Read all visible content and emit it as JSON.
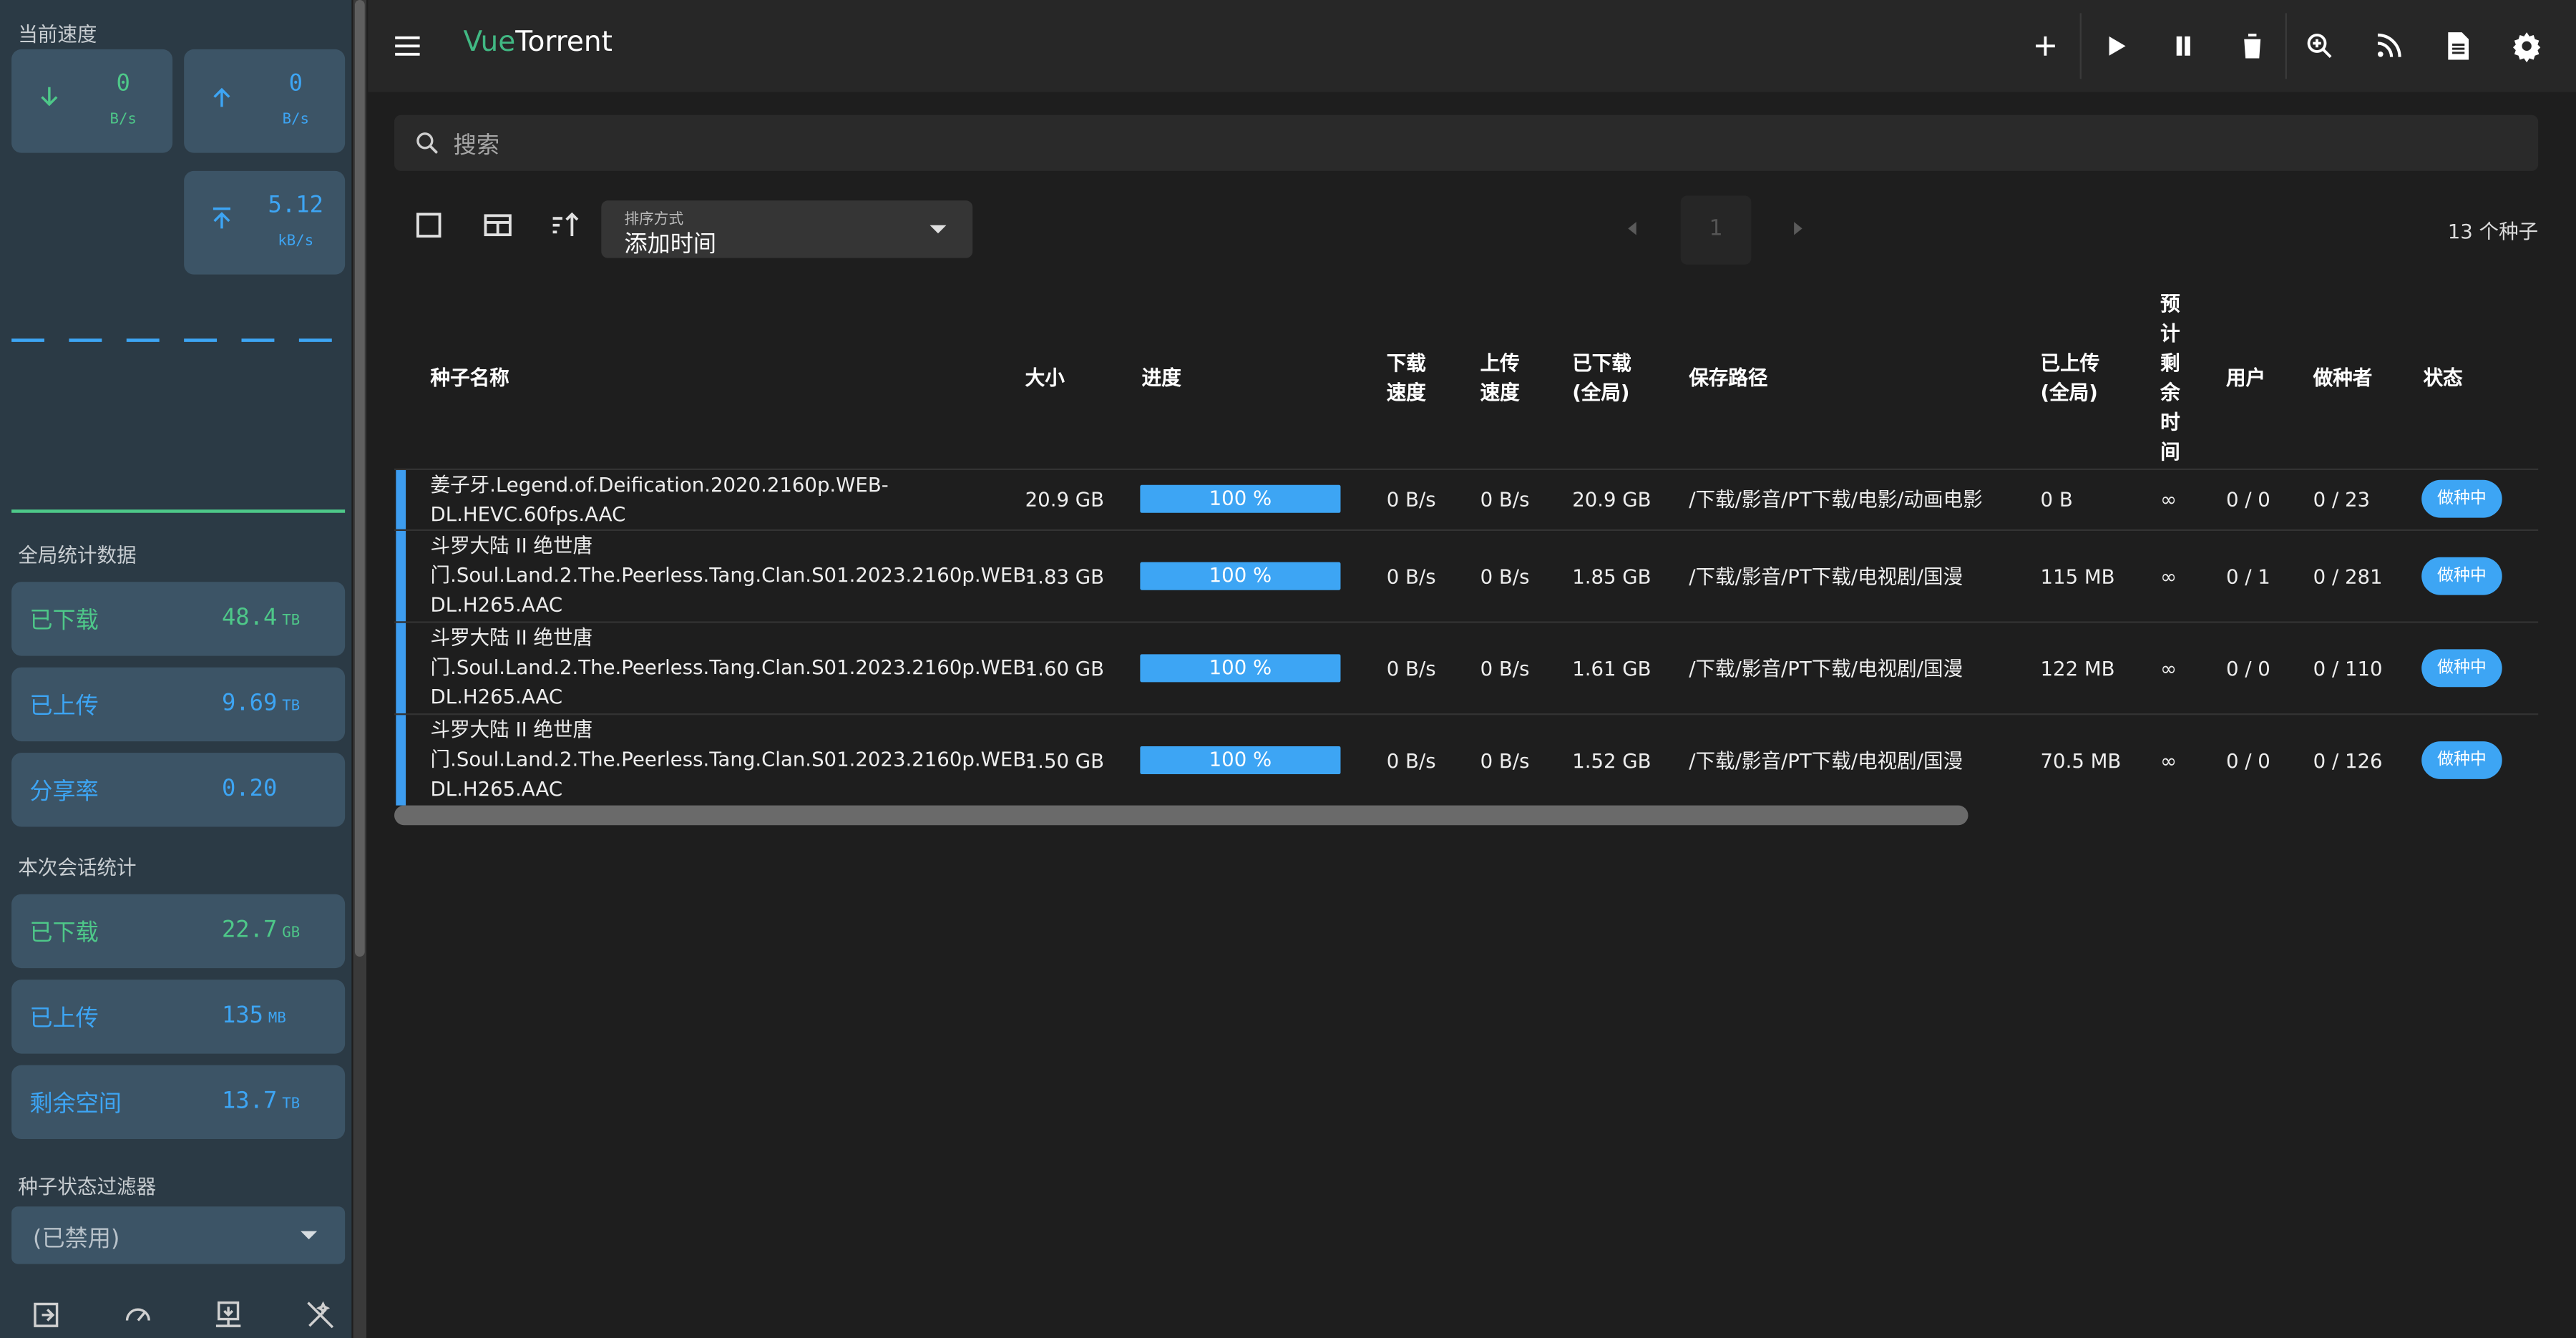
{
  "app": {
    "title_prefix": "Vue",
    "title_suffix": "Torrent"
  },
  "sidebar": {
    "current_speed_label": "当前速度",
    "download_speed": {
      "value": "0",
      "unit": "B/s"
    },
    "upload_speed": {
      "value": "0",
      "unit": "B/s"
    },
    "alt_speed": {
      "value": "5.12",
      "unit": "kB/s"
    },
    "global_stats_label": "全局统计数据",
    "global_stats": [
      {
        "label": "已下载",
        "value": "48.4",
        "unit": "TB"
      },
      {
        "label": "已上传",
        "value": "9.69",
        "unit": "TB"
      },
      {
        "label": "分享率",
        "value": "0.20",
        "unit": ""
      }
    ],
    "session_stats_label": "本次会话统计",
    "session_stats": [
      {
        "label": "已下载",
        "value": "22.7",
        "unit": "GB"
      },
      {
        "label": "已上传",
        "value": "135",
        "unit": "MB"
      },
      {
        "label": "剩余空间",
        "value": "13.7",
        "unit": "TB"
      }
    ],
    "filter_label": "种子状态过滤器",
    "filter_value": "(已禁用)",
    "bottom_icons": [
      "logout-icon",
      "speedometer-icon",
      "download-network-icon",
      "wand-off-icon"
    ]
  },
  "toolbar": {
    "buttons": [
      "add-icon",
      "play-icon",
      "pause-icon",
      "delete-icon",
      "search-plugin-icon",
      "rss-icon",
      "log-icon",
      "settings-icon"
    ]
  },
  "search": {
    "placeholder": "搜索"
  },
  "sort": {
    "label": "排序方式",
    "value": "添加时间"
  },
  "pagination": {
    "page": "1"
  },
  "torrent_count": "13 个种子",
  "table": {
    "headers": {
      "name": "种子名称",
      "size": "大小",
      "progress": "进度",
      "dl_speed_1": "下载",
      "dl_speed_2": "速度",
      "up_speed_1": "上传",
      "up_speed_2": "速度",
      "downloaded_1": "已下载",
      "downloaded_2": "(全局)",
      "save_path": "保存路径",
      "uploaded_1": "已上传",
      "uploaded_2": "(全局)",
      "eta_1": "预",
      "eta_2": "计",
      "eta_3": "剩",
      "eta_4": "余",
      "eta_5": "时",
      "eta_6": "间",
      "peers": "用户",
      "seeds": "做种者",
      "status": "状态"
    },
    "rows": [
      {
        "name_1": "姜子牙.Legend.of.Deification.2020.2160p.WEB-",
        "name_2": "DL.HEVC.60fps.AAC",
        "name_3": "",
        "size": "20.9 GB",
        "progress": "100 %",
        "dl_speed": "0 B/s",
        "up_speed": "0 B/s",
        "downloaded": "20.9 GB",
        "save_path": "/下载/影音/PT下载/电影/动画电影",
        "uploaded": "0 B",
        "eta": "∞",
        "peers": "0 / 0",
        "seeds": "0 / 23",
        "status": "做种中"
      },
      {
        "name_1": "斗罗大陆 II 绝世唐",
        "name_2": "门.Soul.Land.2.The.Peerless.Tang.Clan.S01.2023.2160p.WEB-",
        "name_3": "DL.H265.AAC",
        "size": "1.83 GB",
        "progress": "100 %",
        "dl_speed": "0 B/s",
        "up_speed": "0 B/s",
        "downloaded": "1.85 GB",
        "save_path": "/下载/影音/PT下载/电视剧/国漫",
        "uploaded": "115 MB",
        "eta": "∞",
        "peers": "0 / 1",
        "seeds": "0 / 281",
        "status": "做种中"
      },
      {
        "name_1": "斗罗大陆 II 绝世唐",
        "name_2": "门.Soul.Land.2.The.Peerless.Tang.Clan.S01.2023.2160p.WEB-",
        "name_3": "DL.H265.AAC",
        "size": "1.60 GB",
        "progress": "100 %",
        "dl_speed": "0 B/s",
        "up_speed": "0 B/s",
        "downloaded": "1.61 GB",
        "save_path": "/下载/影音/PT下载/电视剧/国漫",
        "uploaded": "122 MB",
        "eta": "∞",
        "peers": "0 / 0",
        "seeds": "0 / 110",
        "status": "做种中"
      },
      {
        "name_1": "斗罗大陆 II 绝世唐",
        "name_2": "门.Soul.Land.2.The.Peerless.Tang.Clan.S01.2023.2160p.WEB-",
        "name_3": "DL.H265.AAC",
        "size": "1.50 GB",
        "progress": "100 %",
        "dl_speed": "0 B/s",
        "up_speed": "0 B/s",
        "downloaded": "1.52 GB",
        "save_path": "/下载/影音/PT下载/电视剧/国漫",
        "uploaded": "70.5 MB",
        "eta": "∞",
        "peers": "0 / 0",
        "seeds": "0 / 126",
        "status": "做种中"
      }
    ]
  },
  "colors": {
    "accent_blue": "#3da5f4",
    "accent_green": "#4ec889",
    "sidebar_bg": "#2b3a45",
    "card_bg": "#3c5466",
    "main_bg": "#1e1e1e"
  }
}
